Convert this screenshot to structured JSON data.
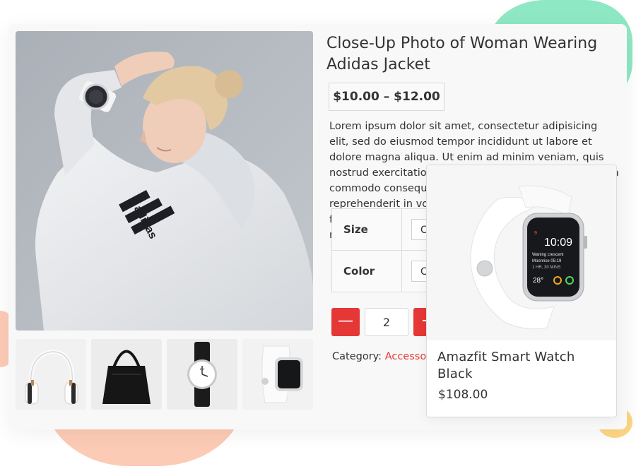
{
  "product": {
    "title": "Close-Up Photo of Woman Wearing Adidas Jacket",
    "price_range": "$10.00 – $12.00",
    "description": "Lorem ipsum dolor sit amet, consectetur adipisicing elit, sed do eiusmod tempor incididunt ut labore et dolore magna aliqua. Ut enim ad minim veniam, quis nostrud exercitation ullamco laboris nisi ut aliquip ex ea commodo consequat. Duis aute irure dolor in reprehenderit in voluptate velit esse cillum dolore eu fugiat nulla pariatur. Excepteur sint occaecat cupidatat non proident, mattis vulputate, tristique ut lectus.",
    "attributes": [
      {
        "label": "Size",
        "value": "C"
      },
      {
        "label": "Color",
        "value": "C"
      }
    ],
    "quantity": "2",
    "minus_label": "—",
    "plus_label": "+",
    "category_label": "Category:",
    "category_value": "Accessories"
  },
  "gallery": {
    "thumbnails": [
      {
        "icon": "headphones"
      },
      {
        "icon": "handbag"
      },
      {
        "icon": "wristwatch"
      },
      {
        "icon": "smartwatch"
      }
    ]
  },
  "popup": {
    "title": "Amazfit Smart Watch Black",
    "price": "$108.00",
    "watch_screen": {
      "day": "9",
      "time": "10:09",
      "line1": "Waning crescent",
      "line2": "Moonrise 05:19",
      "line3": "1 HR, 30 MINS",
      "temp": "28°"
    }
  },
  "colors": {
    "accent": "#e63737",
    "blob_green": "#8fe8c4",
    "blob_peach": "#fccbb5",
    "blob_yellow": "#fdd784"
  }
}
